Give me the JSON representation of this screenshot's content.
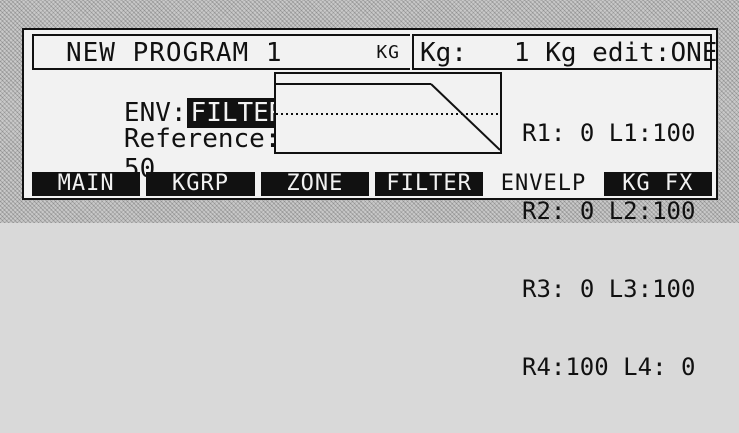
{
  "header": {
    "program_title": "NEW PROGRAM 1",
    "kg_tag": "KG",
    "kg_info": "Kg:   1 Kg edit:ONE"
  },
  "envelope": {
    "env_label": "ENV:",
    "env_value": "FILTER",
    "reference_label": "Reference:",
    "reference_value": "50"
  },
  "params": {
    "rows": [
      {
        "r_label": "R1:",
        "r_value": "0",
        "l_label": "L1:",
        "l_value": "100"
      },
      {
        "r_label": "R2:",
        "r_value": "0",
        "l_label": "L2:",
        "l_value": "100"
      },
      {
        "r_label": "R3:",
        "r_value": "0",
        "l_label": "L3:",
        "l_value": "100"
      },
      {
        "r_label": "R4:",
        "r_value": "100",
        "l_label": "L4:",
        "l_value": "0"
      }
    ]
  },
  "softkeys": [
    {
      "label": "MAIN",
      "active": false
    },
    {
      "label": "KGRP",
      "active": false
    },
    {
      "label": "ZONE",
      "active": false
    },
    {
      "label": "FILTER",
      "active": false
    },
    {
      "label": "ENVELP",
      "active": true
    },
    {
      "label": "KG FX",
      "active": false
    }
  ]
}
